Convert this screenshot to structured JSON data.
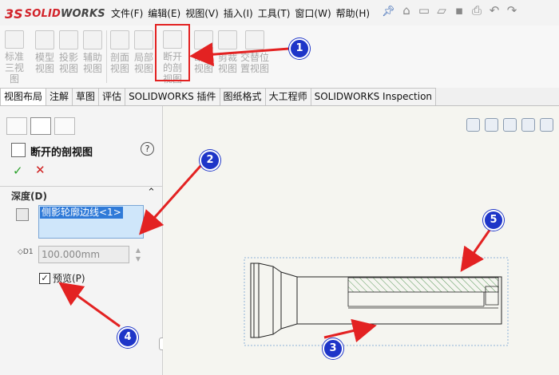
{
  "app": {
    "logo_mark": "3S",
    "logo_text_a": "SOLID",
    "logo_text_b": "WORKS"
  },
  "menus": [
    "文件(F)",
    "编辑(E)",
    "视图(V)",
    "插入(I)",
    "工具(T)",
    "窗口(W)",
    "帮助(H)"
  ],
  "commands": [
    {
      "label": "标准三视图"
    },
    {
      "label": "模型视图"
    },
    {
      "label": "投影视图"
    },
    {
      "label": "辅助视图"
    },
    {
      "label": "剖面视图"
    },
    {
      "label": "局部视图"
    },
    {
      "label": "断开的剖视图"
    },
    {
      "label": "断裂视图"
    },
    {
      "label": "剪裁视图"
    },
    {
      "label": "交替位置视图"
    }
  ],
  "tabs": [
    "视图布局",
    "注解",
    "草图",
    "评估",
    "SOLIDWORKS 插件",
    "图纸格式",
    "大工程师",
    "SOLIDWORKS Inspection"
  ],
  "panel": {
    "title": "断开的剖视图",
    "help": "?",
    "ok": "✓",
    "cancel": "✕",
    "depth_label": "深度(D)",
    "selection_item": "侧影轮廓边线<1>",
    "depth_value": "100.000mm",
    "preview_label": "预览(P)",
    "preview_checked": "✓"
  },
  "badges": [
    "1",
    "2",
    "3",
    "4",
    "5"
  ],
  "colors": {
    "accent": "#1e35c8",
    "arrow": "#e32222",
    "highlight": "#e32222"
  }
}
